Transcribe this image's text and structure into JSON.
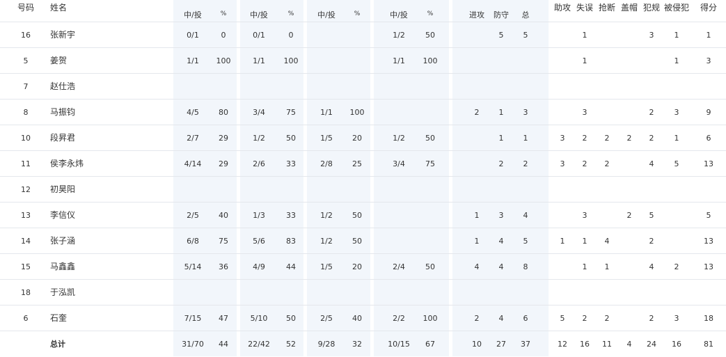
{
  "header": {
    "number": "号码",
    "name": "姓名",
    "sub_made_att": "中/投",
    "sub_pct": "%",
    "rebound_offense": "进攻",
    "rebound_defense": "防守",
    "rebound_total": "总",
    "assists": "助攻",
    "turnovers": "失误",
    "steals": "抢断",
    "blocks": "盖帽",
    "fouls": "犯规",
    "fouled": "被侵犯",
    "points": "得分"
  },
  "rows": [
    {
      "no": "16",
      "name": "张新宇",
      "fg": "0/1",
      "fgp": "0",
      "two": "0/1",
      "twop": "0",
      "three": "",
      "threep": "",
      "ft": "1/2",
      "ftp": "50",
      "oreb": "",
      "dreb": "5",
      "reb": "5",
      "ast": "",
      "tov": "1",
      "stl": "",
      "blk": "",
      "pf": "3",
      "fd": "1",
      "pts": "1"
    },
    {
      "no": "5",
      "name": "姜贺",
      "fg": "1/1",
      "fgp": "100",
      "two": "1/1",
      "twop": "100",
      "three": "",
      "threep": "",
      "ft": "1/1",
      "ftp": "100",
      "oreb": "",
      "dreb": "",
      "reb": "",
      "ast": "",
      "tov": "1",
      "stl": "",
      "blk": "",
      "pf": "",
      "fd": "1",
      "pts": "3"
    },
    {
      "no": "7",
      "name": "赵仕浩",
      "fg": "",
      "fgp": "",
      "two": "",
      "twop": "",
      "three": "",
      "threep": "",
      "ft": "",
      "ftp": "",
      "oreb": "",
      "dreb": "",
      "reb": "",
      "ast": "",
      "tov": "",
      "stl": "",
      "blk": "",
      "pf": "",
      "fd": "",
      "pts": ""
    },
    {
      "no": "8",
      "name": "马振钧",
      "fg": "4/5",
      "fgp": "80",
      "two": "3/4",
      "twop": "75",
      "three": "1/1",
      "threep": "100",
      "ft": "",
      "ftp": "",
      "oreb": "2",
      "dreb": "1",
      "reb": "3",
      "ast": "",
      "tov": "3",
      "stl": "",
      "blk": "",
      "pf": "2",
      "fd": "3",
      "pts": "9"
    },
    {
      "no": "10",
      "name": "段昇君",
      "fg": "2/7",
      "fgp": "29",
      "two": "1/2",
      "twop": "50",
      "three": "1/5",
      "threep": "20",
      "ft": "1/2",
      "ftp": "50",
      "oreb": "",
      "dreb": "1",
      "reb": "1",
      "ast": "3",
      "tov": "2",
      "stl": "2",
      "blk": "2",
      "pf": "2",
      "fd": "1",
      "pts": "6"
    },
    {
      "no": "11",
      "name": "侯李永炜",
      "fg": "4/14",
      "fgp": "29",
      "two": "2/6",
      "twop": "33",
      "three": "2/8",
      "threep": "25",
      "ft": "3/4",
      "ftp": "75",
      "oreb": "",
      "dreb": "2",
      "reb": "2",
      "ast": "3",
      "tov": "2",
      "stl": "2",
      "blk": "",
      "pf": "4",
      "fd": "5",
      "pts": "13"
    },
    {
      "no": "12",
      "name": "初昊阳",
      "fg": "",
      "fgp": "",
      "two": "",
      "twop": "",
      "three": "",
      "threep": "",
      "ft": "",
      "ftp": "",
      "oreb": "",
      "dreb": "",
      "reb": "",
      "ast": "",
      "tov": "",
      "stl": "",
      "blk": "",
      "pf": "",
      "fd": "",
      "pts": ""
    },
    {
      "no": "13",
      "name": "李信仪",
      "fg": "2/5",
      "fgp": "40",
      "two": "1/3",
      "twop": "33",
      "three": "1/2",
      "threep": "50",
      "ft": "",
      "ftp": "",
      "oreb": "1",
      "dreb": "3",
      "reb": "4",
      "ast": "",
      "tov": "3",
      "stl": "",
      "blk": "2",
      "pf": "5",
      "fd": "",
      "pts": "5"
    },
    {
      "no": "14",
      "name": "张子涵",
      "fg": "6/8",
      "fgp": "75",
      "two": "5/6",
      "twop": "83",
      "three": "1/2",
      "threep": "50",
      "ft": "",
      "ftp": "",
      "oreb": "1",
      "dreb": "4",
      "reb": "5",
      "ast": "1",
      "tov": "1",
      "stl": "4",
      "blk": "",
      "pf": "2",
      "fd": "",
      "pts": "13"
    },
    {
      "no": "15",
      "name": "马鑫鑫",
      "fg": "5/14",
      "fgp": "36",
      "two": "4/9",
      "twop": "44",
      "three": "1/5",
      "threep": "20",
      "ft": "2/4",
      "ftp": "50",
      "oreb": "4",
      "dreb": "4",
      "reb": "8",
      "ast": "",
      "tov": "1",
      "stl": "1",
      "blk": "",
      "pf": "4",
      "fd": "2",
      "pts": "13"
    },
    {
      "no": "18",
      "name": "于泓凯",
      "fg": "",
      "fgp": "",
      "two": "",
      "twop": "",
      "three": "",
      "threep": "",
      "ft": "",
      "ftp": "",
      "oreb": "",
      "dreb": "",
      "reb": "",
      "ast": "",
      "tov": "",
      "stl": "",
      "blk": "",
      "pf": "",
      "fd": "",
      "pts": ""
    },
    {
      "no": "6",
      "name": "石奎",
      "fg": "7/15",
      "fgp": "47",
      "two": "5/10",
      "twop": "50",
      "three": "2/5",
      "threep": "40",
      "ft": "2/2",
      "ftp": "100",
      "oreb": "2",
      "dreb": "4",
      "reb": "6",
      "ast": "5",
      "tov": "2",
      "stl": "2",
      "blk": "",
      "pf": "2",
      "fd": "3",
      "pts": "18"
    }
  ],
  "total": {
    "no": "",
    "name": "总计",
    "fg": "31/70",
    "fgp": "44",
    "two": "22/42",
    "twop": "52",
    "three": "9/28",
    "threep": "32",
    "ft": "10/15",
    "ftp": "67",
    "oreb": "10",
    "dreb": "27",
    "reb": "37",
    "ast": "12",
    "tov": "16",
    "stl": "11",
    "blk": "4",
    "pf": "24",
    "fd": "16",
    "pts": "81"
  },
  "colors": {
    "column_shade": "#f2f6fb",
    "row_border": "#e4e7ec",
    "text": "#333333"
  }
}
